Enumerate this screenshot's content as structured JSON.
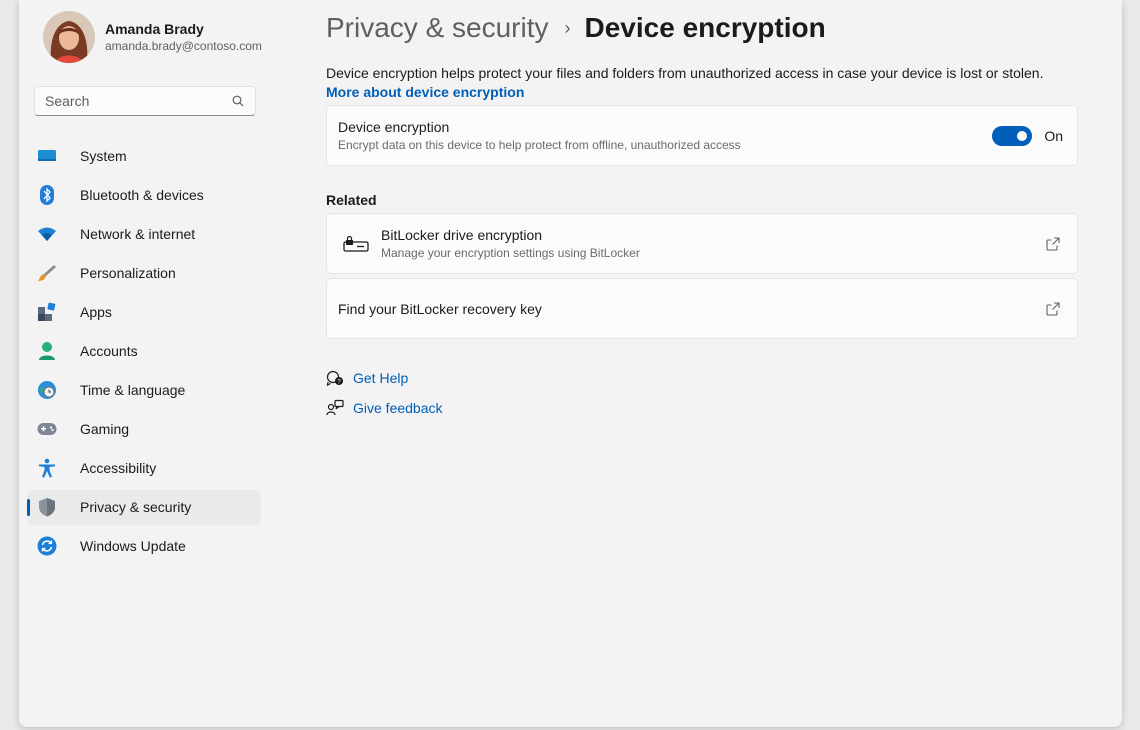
{
  "profile": {
    "name": "Amanda Brady",
    "email": "amanda.brady@contoso.com"
  },
  "search": {
    "placeholder": "Search"
  },
  "nav": {
    "items": [
      {
        "label": "System",
        "icon": "system-icon"
      },
      {
        "label": "Bluetooth & devices",
        "icon": "bluetooth-icon"
      },
      {
        "label": "Network & internet",
        "icon": "wifi-icon"
      },
      {
        "label": "Personalization",
        "icon": "brush-icon"
      },
      {
        "label": "Apps",
        "icon": "apps-icon"
      },
      {
        "label": "Accounts",
        "icon": "person-icon"
      },
      {
        "label": "Time & language",
        "icon": "globe-clock-icon"
      },
      {
        "label": "Gaming",
        "icon": "gamepad-icon"
      },
      {
        "label": "Accessibility",
        "icon": "accessibility-icon"
      },
      {
        "label": "Privacy & security",
        "icon": "shield-icon",
        "selected": true
      },
      {
        "label": "Windows Update",
        "icon": "update-icon"
      }
    ]
  },
  "breadcrumb": {
    "parent": "Privacy & security",
    "separator": "›",
    "current": "Device encryption"
  },
  "description": {
    "text": "Device encryption helps protect your files and folders from unauthorized access in case your device is lost or stolen. ",
    "link": "More about device encryption"
  },
  "encryption_card": {
    "title": "Device encryption",
    "subtitle": "Encrypt data on this device to help protect from offline, unauthorized access",
    "toggle_state": "On",
    "toggle_on": true
  },
  "related": {
    "heading": "Related",
    "bitlocker": {
      "title": "BitLocker drive encryption",
      "subtitle": "Manage your encryption settings using BitLocker"
    },
    "recovery": {
      "title": "Find your BitLocker recovery key"
    }
  },
  "help": {
    "get_help": "Get Help",
    "give_feedback": "Give feedback"
  },
  "colors": {
    "accent": "#005fb8",
    "background": "#f3f3f3",
    "card": "#fbfbfb"
  }
}
